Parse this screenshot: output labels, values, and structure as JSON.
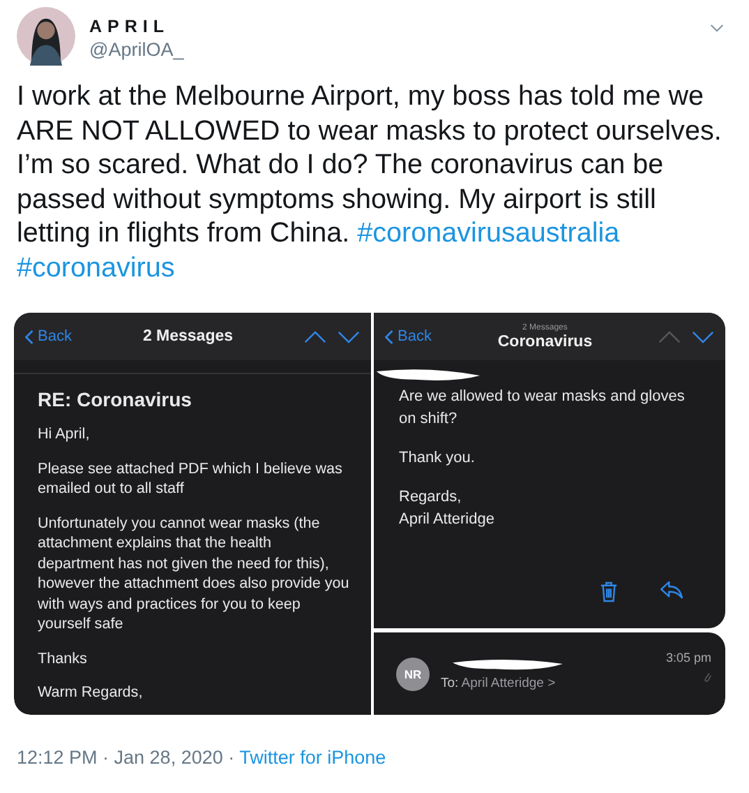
{
  "author": {
    "name": "APRIL",
    "handle": "@AprilOA_"
  },
  "tweet_text": [
    {
      "kind": "text",
      "text": "I work at the Melbourne Airport, my boss has told me we ARE NOT ALLOWED to wear masks to protect ourselves. I’m so scared. What do I do? The coronavirus can be passed without symptoms showing. My airport is still letting in flights from China. "
    },
    {
      "kind": "hashtag",
      "text": "#coronavirusaustralia"
    },
    {
      "kind": "hashtag",
      "text": "#coronavirus"
    }
  ],
  "screenshots": {
    "left": {
      "back": "Back",
      "title": "2 Messages",
      "nav": {
        "up_disabled": false,
        "down_disabled": false
      },
      "subject": "RE:  Coronavirus",
      "paragraphs": [
        "Hi April,",
        "Please see attached PDF which I believe was emailed out to all staff",
        "Unfortunately you cannot wear masks (the attachment explains that the health department has not given the need for this), however the attachment does also provide you with ways and practices for you to keep yourself safe",
        "Thanks",
        "Warm Regards,"
      ]
    },
    "right": {
      "back": "Back",
      "subtitle": "2 Messages",
      "title": "Coronavirus",
      "nav": {
        "up_disabled": true,
        "down_disabled": false
      },
      "paragraphs": [
        "Are we allowed to wear masks and gloves on shift?",
        "Thank you.",
        "Regards,\nApril Atteridge"
      ],
      "sender": {
        "initials": "NR",
        "to_label": "To:",
        "to": "April Atteridge >",
        "time": "3:05 pm"
      }
    }
  },
  "footer": {
    "timestamp": "12:12 PM · Jan 28, 2020 · ",
    "source": "Twitter for iPhone"
  }
}
